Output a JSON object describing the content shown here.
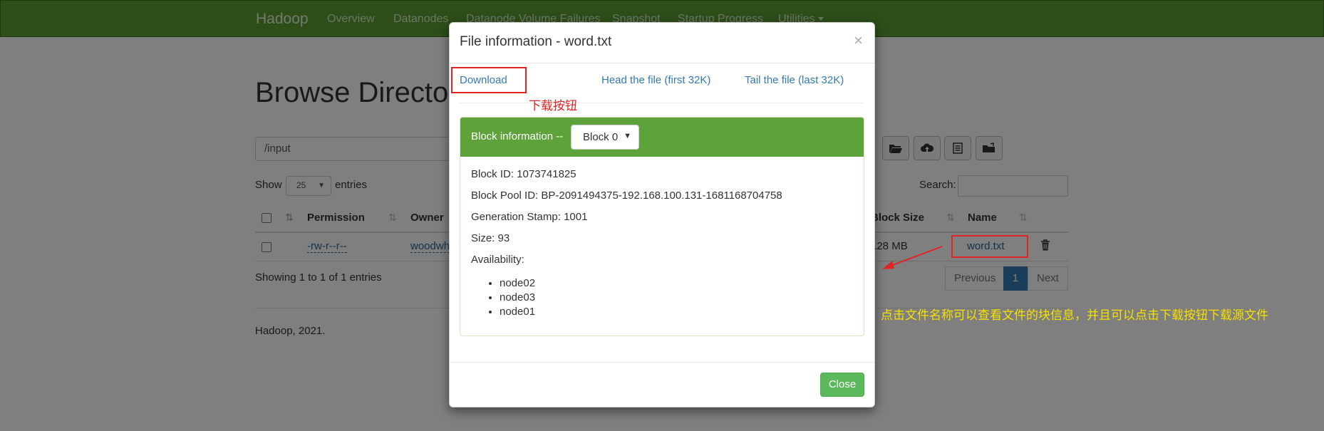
{
  "navbar": {
    "brand": "Hadoop",
    "items": [
      "Overview",
      "Datanodes",
      "Datanode Volume Failures",
      "Snapshot",
      "Startup Progress",
      "Utilities"
    ]
  },
  "page": {
    "title": "Browse Directory",
    "path_value": "/input",
    "show_label": "Show",
    "entries_value": "25",
    "entries_label": "entries",
    "search_label": "Search:",
    "columns": [
      "Permission",
      "Owner",
      "Block Size",
      "Name"
    ],
    "row": {
      "permission": "-rw-r--r--",
      "owner": "woodwh",
      "block_size": "128 MB",
      "name": "word.txt"
    },
    "showing": "Showing 1 to 1 of 1 entries",
    "pager": {
      "previous": "Previous",
      "current": "1",
      "next": "Next"
    },
    "footer": "Hadoop, 2021."
  },
  "modal": {
    "title": "File information - word.txt",
    "close_x": "×",
    "links": {
      "download": "Download",
      "head": "Head the file (first 32K)",
      "tail": "Tail the file (last 32K)"
    },
    "block_label": "Block information --",
    "block_select": "Block 0",
    "block_id": "Block ID: 1073741825",
    "block_pool": "Block Pool ID: BP-2091494375-192.168.100.131-1681168704758",
    "generation_stamp": "Generation Stamp: 1001",
    "size": "Size: 93",
    "availability": "Availability:",
    "nodes": [
      "node02",
      "node03",
      "node01"
    ],
    "close_button": "Close"
  },
  "annotations": {
    "download_note": "下载按钮",
    "name_note": "点击文件名称可以查看文件的块信息，并且可以点击下载按钮下载源文件"
  },
  "colors": {
    "navbar": "#5a9c33",
    "panel_heading": "#5ea23a",
    "link": "#337ab7",
    "close_button": "#5cb85c",
    "annotation_red": "#e02424",
    "annotation_yellow": "#f5e000"
  }
}
